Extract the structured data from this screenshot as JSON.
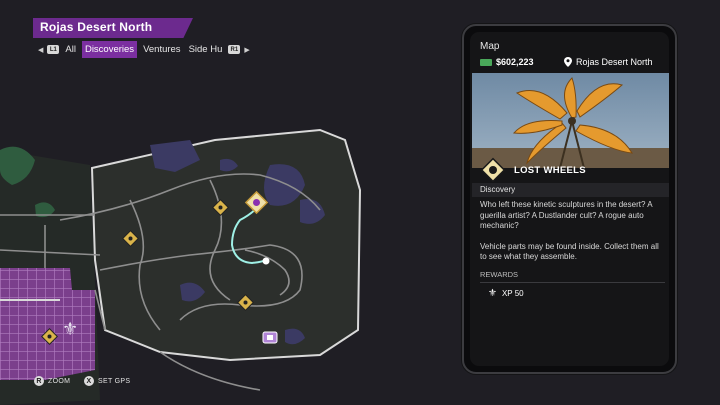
{
  "header": {
    "region_title": "Rojas Desert North",
    "bumper_left": "L1",
    "bumper_right": "R1",
    "tabs": [
      {
        "label": "All",
        "active": false
      },
      {
        "label": "Discoveries",
        "active": true
      },
      {
        "label": "Ventures",
        "active": false
      },
      {
        "label": "Side Hu",
        "active": false
      }
    ]
  },
  "footer": {
    "zoom_button": "R",
    "zoom_label": "ZOOM",
    "gps_button": "X",
    "gps_label": "SET GPS"
  },
  "phone": {
    "app_title": "Map",
    "cash": "$602,223",
    "location": "Rojas Desert North",
    "activity": {
      "name": "LOST WHEELS",
      "category": "Discovery",
      "description": [
        "Who left these kinetic sculptures in the desert? A guerilla artist? A Dustlander cult? A rogue auto mechanic?",
        "Vehicle parts may be found inside. Collect them all to see what they assemble."
      ]
    },
    "rewards_label": "REWARDS",
    "reward": "XP 50"
  },
  "colors": {
    "accent_purple": "#7b2fa0",
    "marker_gold": "#d9b34a",
    "route_cyan": "#9ff0e6",
    "cash_green": "#4aa85a"
  },
  "icons": [
    "lost-wheels-marker-icon",
    "player-location-icon",
    "shop-marker-icon",
    "cash-icon",
    "location-pin-icon",
    "fleur-de-lis-icon"
  ]
}
